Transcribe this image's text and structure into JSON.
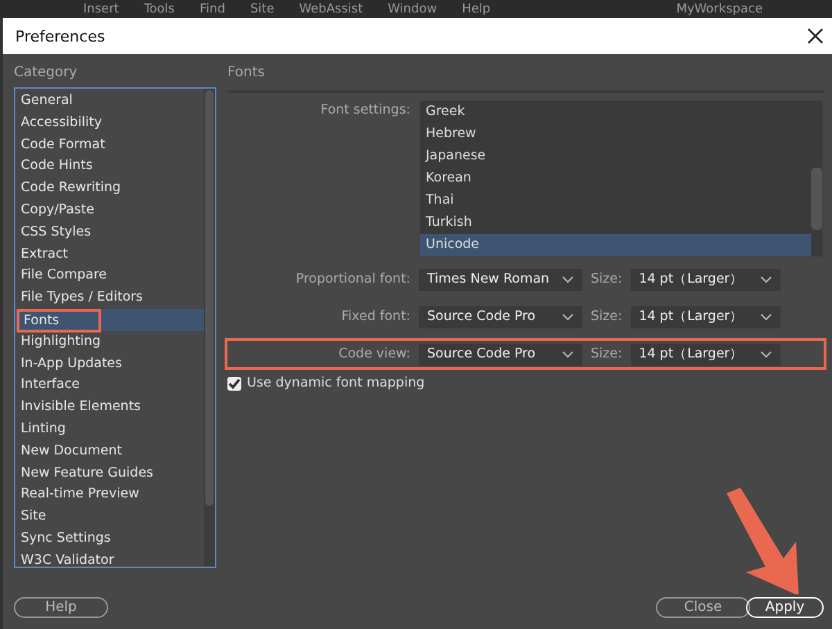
{
  "app_menu": [
    "Insert",
    "Tools",
    "Find",
    "Site",
    "WebAssist",
    "Window",
    "Help"
  ],
  "workspace": "MyWorkspace",
  "window": {
    "title": "Preferences"
  },
  "category": {
    "label": "Category",
    "items": [
      {
        "label": "General",
        "selected": false,
        "annotated": false
      },
      {
        "label": "Accessibility",
        "selected": false,
        "annotated": false
      },
      {
        "label": "Code Format",
        "selected": false,
        "annotated": false
      },
      {
        "label": "Code Hints",
        "selected": false,
        "annotated": false
      },
      {
        "label": "Code Rewriting",
        "selected": false,
        "annotated": false
      },
      {
        "label": "Copy/Paste",
        "selected": false,
        "annotated": false
      },
      {
        "label": "CSS Styles",
        "selected": false,
        "annotated": false
      },
      {
        "label": "Extract",
        "selected": false,
        "annotated": false
      },
      {
        "label": "File Compare",
        "selected": false,
        "annotated": false
      },
      {
        "label": "File Types / Editors",
        "selected": false,
        "annotated": false
      },
      {
        "label": "Fonts",
        "selected": true,
        "annotated": true
      },
      {
        "label": "Highlighting",
        "selected": false,
        "annotated": false
      },
      {
        "label": "In-App Updates",
        "selected": false,
        "annotated": false
      },
      {
        "label": "Interface",
        "selected": false,
        "annotated": false
      },
      {
        "label": "Invisible Elements",
        "selected": false,
        "annotated": false
      },
      {
        "label": "Linting",
        "selected": false,
        "annotated": false
      },
      {
        "label": "New Document",
        "selected": false,
        "annotated": false
      },
      {
        "label": "New Feature Guides",
        "selected": false,
        "annotated": false
      },
      {
        "label": "Real-time Preview",
        "selected": false,
        "annotated": false
      },
      {
        "label": "Site",
        "selected": false,
        "annotated": false
      },
      {
        "label": "Sync Settings",
        "selected": false,
        "annotated": false
      },
      {
        "label": "W3C Validator",
        "selected": false,
        "annotated": false
      }
    ]
  },
  "panel": {
    "title": "Fonts",
    "font_settings": {
      "label": "Font settings:",
      "items": [
        {
          "label": "Greek",
          "selected": false
        },
        {
          "label": "Hebrew",
          "selected": false
        },
        {
          "label": "Japanese",
          "selected": false
        },
        {
          "label": "Korean",
          "selected": false
        },
        {
          "label": "Thai",
          "selected": false
        },
        {
          "label": "Turkish",
          "selected": false
        },
        {
          "label": "Unicode",
          "selected": true
        }
      ]
    },
    "font_rows": [
      {
        "label": "Proportional font:",
        "font": "Times New Roman",
        "size_label": "Size:",
        "size": "14 pt（Larger）",
        "annotated": false
      },
      {
        "label": "Fixed font:",
        "font": "Source Code Pro",
        "size_label": "Size:",
        "size": "14 pt（Larger）",
        "annotated": false
      },
      {
        "label": "Code view:",
        "font": "Source Code Pro",
        "size_label": "Size:",
        "size": "14 pt（Larger）",
        "annotated": true
      }
    ],
    "dynamic_mapping": {
      "label": "Use dynamic font mapping",
      "checked": true
    }
  },
  "buttons": {
    "help": "Help",
    "close": "Close",
    "apply": "Apply"
  }
}
